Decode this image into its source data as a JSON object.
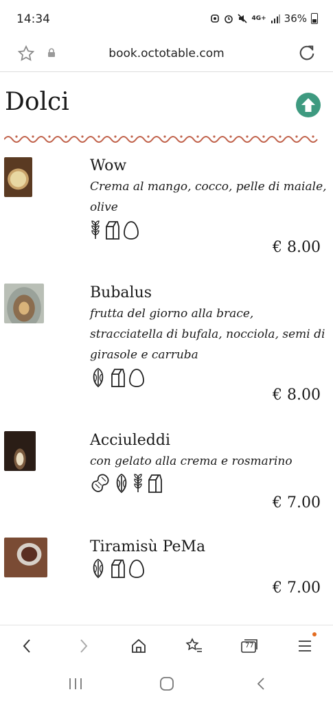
{
  "status_bar": {
    "time": "14:34",
    "network": "4G+",
    "battery": "36%"
  },
  "browser": {
    "url": "book.octotable.com"
  },
  "page": {
    "title": "Dolci"
  },
  "colors": {
    "accent_green": "#3e9a80",
    "wave": "#c0614a"
  },
  "items": [
    {
      "name": "Wow",
      "description": "Crema al mango, cocco, pelle di maiale, olive",
      "price": "€ 8.00",
      "allergens": [
        "wheat-icon",
        "milk-carton-icon",
        "egg-icon"
      ]
    },
    {
      "name": "Bubalus",
      "description": "frutta del giorno alla brace, stracciatella di bufala, nocciola, semi di girasole e carruba",
      "price": "€ 8.00",
      "allergens": [
        "nut-icon",
        "milk-carton-icon",
        "egg-icon"
      ]
    },
    {
      "name": "Acciuleddi",
      "description": "con gelato alla crema e rosmarino",
      "price": "€ 7.00",
      "allergens": [
        "peanut-icon",
        "nut-icon",
        "wheat-icon",
        "milk-carton-icon"
      ]
    },
    {
      "name": "Tiramisù PeMa",
      "description": "",
      "price": "€ 7.00",
      "allergens": [
        "nut-icon",
        "milk-carton-icon",
        "egg-icon"
      ]
    }
  ],
  "bottom_nav": {
    "tabs_count": "77"
  }
}
